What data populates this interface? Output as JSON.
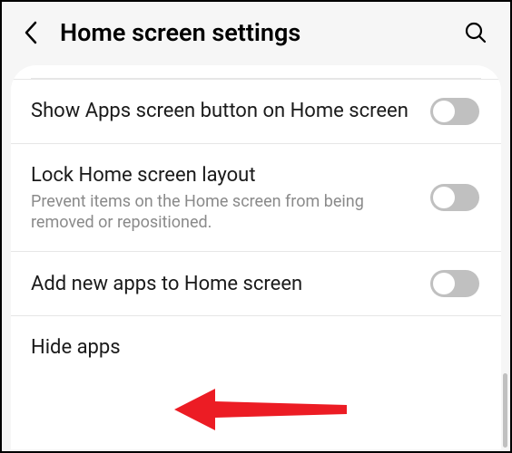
{
  "header": {
    "title": "Home screen settings"
  },
  "rows": [
    {
      "title": "Show Apps screen button on Home screen",
      "subtitle": "",
      "toggle": false
    },
    {
      "title": "Lock Home screen layout",
      "subtitle": "Prevent items on the Home screen from being removed or repositioned.",
      "toggle": false
    },
    {
      "title": "Add new apps to Home screen",
      "subtitle": "",
      "toggle": false
    },
    {
      "title": "Hide apps",
      "subtitle": "",
      "toggle": null
    }
  ],
  "annotation": {
    "color": "#ec1c24"
  }
}
